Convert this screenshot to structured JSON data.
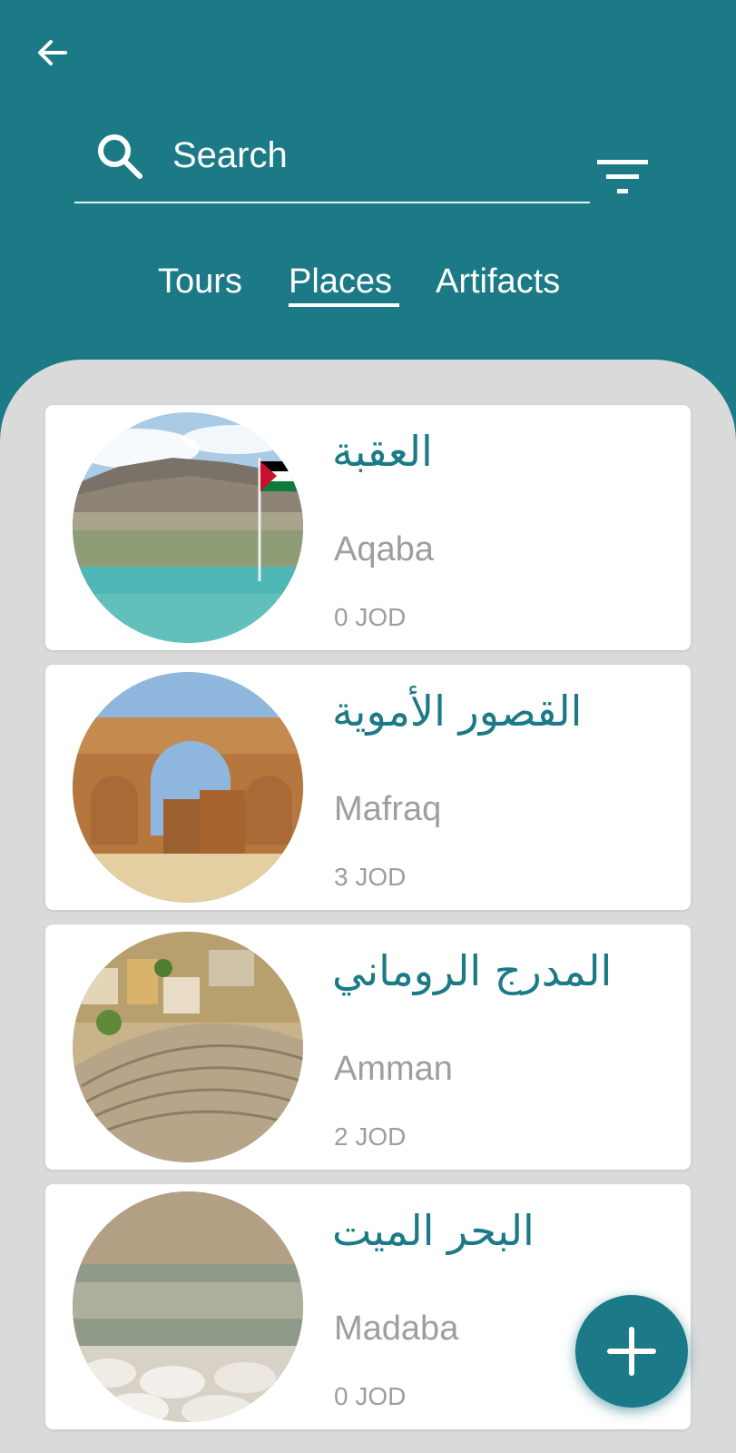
{
  "header": {
    "back_icon": "arrow-left-icon",
    "search": {
      "placeholder": "Search",
      "value": "",
      "icon": "search-icon"
    },
    "filter_icon": "filter-icon"
  },
  "tabs": [
    {
      "label": "Tours",
      "active": false
    },
    {
      "label": "Places",
      "active": true
    },
    {
      "label": "Artifacts",
      "active": false
    }
  ],
  "places": [
    {
      "title_ar": "العقبة",
      "city": "Aqaba",
      "price": "0 JOD",
      "image": "aqaba-coast-flag"
    },
    {
      "title_ar": "القصور الأموية",
      "city": "Mafraq",
      "price": "3 JOD",
      "image": "umayyad-palace-arches"
    },
    {
      "title_ar": "المدرج الروماني",
      "city": "Amman",
      "price": "2 JOD",
      "image": "roman-amphitheater"
    },
    {
      "title_ar": "البحر الميت",
      "city": "Madaba",
      "price": "0 JOD",
      "image": "dead-sea-salt-rocks"
    }
  ],
  "fab": {
    "icon": "plus-icon"
  },
  "colors": {
    "primary": "#1b7a86",
    "panel": "#dadada",
    "card": "#ffffff",
    "muted_text": "#9e9e9e"
  }
}
